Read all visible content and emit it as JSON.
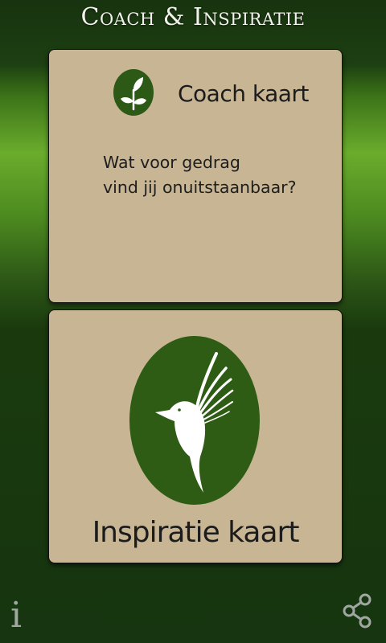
{
  "header": {
    "title": "Coach & Inspiratie"
  },
  "coach_card": {
    "label": "Coach kaart",
    "question_line1": "Wat voor gedrag",
    "question_line2": "vind jij onuitstaanbaar?"
  },
  "inspiration_card": {
    "label": "Inspiratie kaart"
  },
  "toolbar": {
    "info_glyph": "i"
  },
  "icons": {
    "coach": "leaf-icon",
    "inspiration": "hummingbird-icon",
    "info": "info-icon",
    "share": "share-icon"
  },
  "colors": {
    "card_background": "#c7b593",
    "badge_green": "#2c5a16",
    "title_text": "#f2f2ec",
    "toolbar_icon": "#9fa7a0"
  }
}
